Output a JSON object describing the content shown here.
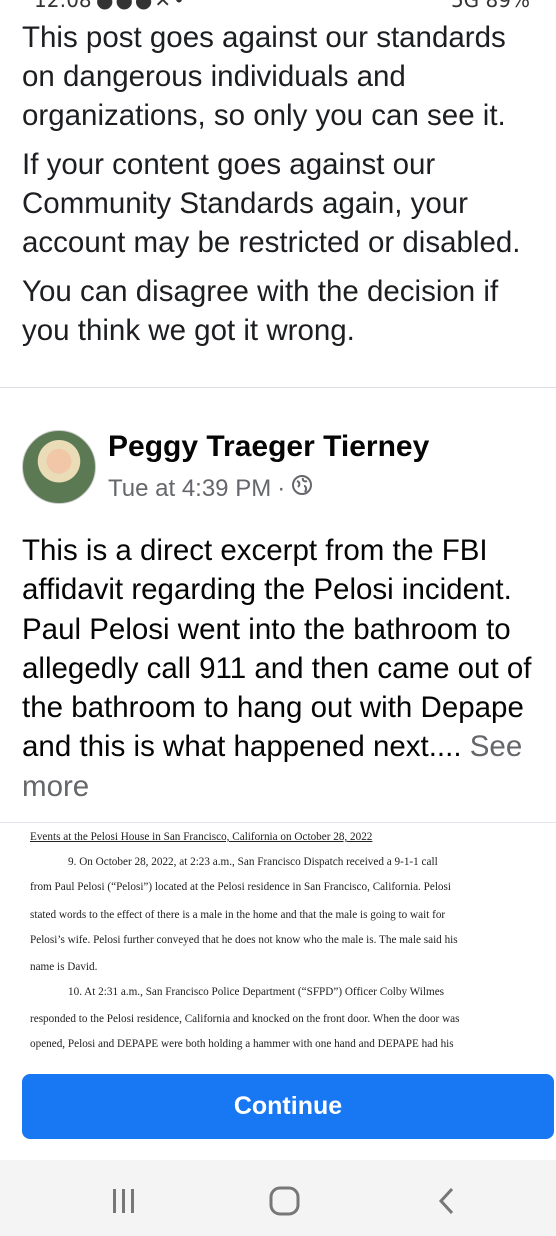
{
  "status_bar": {
    "time": "12:08",
    "signal": "5G",
    "battery": "89%"
  },
  "notice": {
    "paragraphs": [
      "This post goes against our standards on dangerous individuals and organizations, so only you can see it.",
      "If your content goes against our Community Standards again, your account may be restricted or disabled.",
      "You can disagree with the decision if you think we got it wrong."
    ]
  },
  "post": {
    "author": "Peggy Traeger Tierney",
    "time": "Tue at 4:39 PM",
    "separator": "·",
    "body": "This is a direct excerpt from the FBI affidavit regarding the Pelosi incident. Paul Pelosi went into the bathroom to allegedly call 911 and then came out of the bathroom to hang out with Depape and this is what happened next....",
    "see_more": "See more"
  },
  "excerpt": {
    "heading": "Events at the Pelosi House in San Francisco, California on October 28, 2022",
    "lines": [
      "9.        On October 28, 2022, at 2:23 a.m., San Francisco Dispatch received a 9-1-1 call",
      "from Paul Pelosi (“Pelosi”) located at the Pelosi residence in San Francisco, California. Pelosi",
      "stated words to the effect of there is a male in the home and that the male is going to wait for",
      "Pelosi’s wife. Pelosi further conveyed that he does not know who the male is.  The male said his",
      "name is David.",
      "10.       At 2:31 a.m., San Francisco Police Department (“SFPD”) Officer Colby Wilmes",
      "responded to the Pelosi residence, California and knocked on the front door. When the door was",
      "opened, Pelosi and DEPAPE were both holding a hammer with one hand and DEPAPE had his"
    ]
  },
  "continue_button": {
    "label": "Continue"
  },
  "colors": {
    "primary": "#1877f2",
    "secondary_text": "#65676b"
  },
  "nav_icons": [
    "recent-apps-icon",
    "home-icon",
    "back-icon"
  ]
}
